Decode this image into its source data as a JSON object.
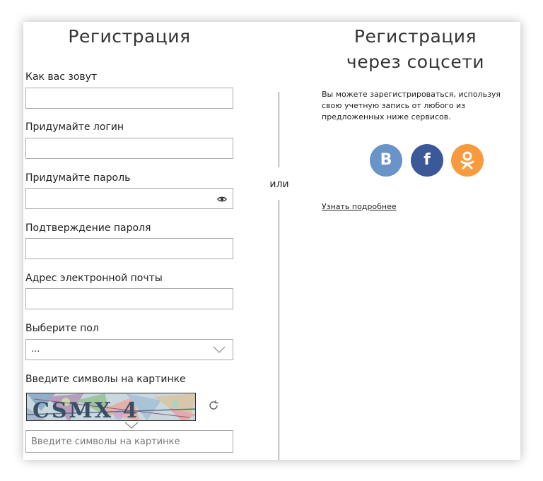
{
  "registration": {
    "title": "Регистрация",
    "fields": [
      {
        "label": "Как вас зовут",
        "value": ""
      },
      {
        "label": "Придумайте логин",
        "value": ""
      },
      {
        "label": "Придумайте пароль",
        "value": ""
      },
      {
        "label": "Подтверждение пароля",
        "value": ""
      },
      {
        "label": "Адрес электронной почты",
        "value": ""
      }
    ],
    "gender": {
      "label": "Выберите пол",
      "selected": "..."
    },
    "captcha": {
      "label": "Введите символы на картинке",
      "image_text": "CSMX 4",
      "input_placeholder": "Введите символы на картинке"
    }
  },
  "divider": {
    "or_label": "или"
  },
  "social": {
    "title_line1": "Регистрация",
    "title_line2": "через соцсети",
    "description": "Вы можете зарегистрироваться, используя свою учетную запись от любого из предложенных ниже сервисов.",
    "services": [
      {
        "name": "vk",
        "glyph": "B",
        "color": "#6a93c7"
      },
      {
        "name": "facebook",
        "glyph": "f",
        "color": "#3b5998"
      },
      {
        "name": "odnoklassniki",
        "glyph": "ok",
        "color": "#f89a3e"
      }
    ],
    "more_link": "Узнать подробнее"
  }
}
